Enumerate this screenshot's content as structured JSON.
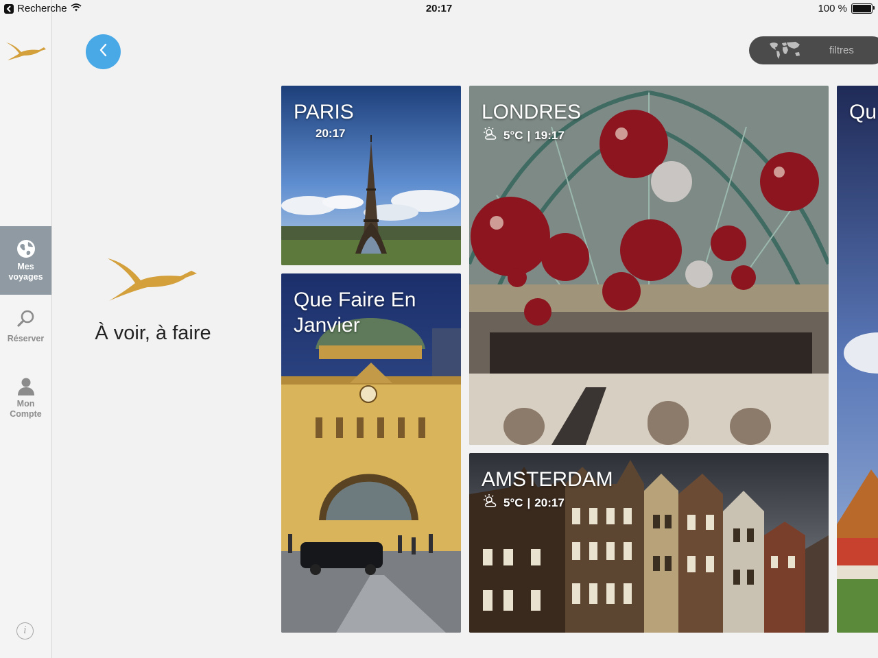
{
  "status_bar": {
    "back_app": "Recherche",
    "time": "20:17",
    "battery": "100 %",
    "battery_level": 1.0
  },
  "sidebar": {
    "items": [
      {
        "label": "Mes voyages",
        "icon": "globe-icon",
        "active": true
      },
      {
        "label": "Réserver",
        "icon": "search-icon",
        "active": false
      },
      {
        "label": "Mon Compte",
        "icon": "person-icon",
        "active": false
      }
    ],
    "info_icon": "info-icon"
  },
  "header": {
    "filters_label": "filtres",
    "back_icon": "chevron-left-icon"
  },
  "hero": {
    "title": "À voir, à faire"
  },
  "tiles": {
    "paris": {
      "title": "PARIS",
      "time": "20:17"
    },
    "que_faire": {
      "title": "Que Faire En Janvier"
    },
    "londres": {
      "title": "LONDRES",
      "temp": "5°C",
      "separator": "|",
      "time": "19:17",
      "weather_icon": "partly-cloudy-icon"
    },
    "amsterdam": {
      "title": "AMSTERDAM",
      "temp": "5°C",
      "separator": "|",
      "time": "20:17",
      "weather_icon": "partly-cloudy-icon"
    },
    "partial": {
      "title": "Qu"
    }
  },
  "colors": {
    "accent_blue": "#49a8e6",
    "brand_gold": "#d3a03c",
    "sidebar_active": "#8f9aa3",
    "filters_bg": "#4b4b4b"
  }
}
